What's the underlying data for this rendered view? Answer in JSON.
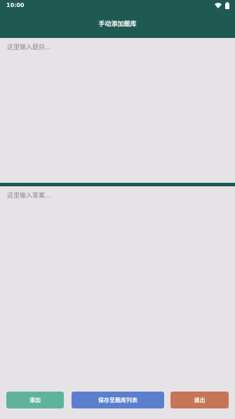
{
  "status_bar": {
    "time": "10:00",
    "icons": [
      "wifi-icon",
      "battery-icon"
    ]
  },
  "header": {
    "title": "手动添加题库"
  },
  "question_input": {
    "value": "",
    "placeholder": "这里输入题目..."
  },
  "answer_input": {
    "value": "",
    "placeholder": "这里输入答案..."
  },
  "buttons": {
    "add_label": "添加",
    "save_label": "保存至题库列表",
    "exit_label": "退出"
  },
  "colors": {
    "header_bg": "#1f5a52",
    "page_bg": "#e6e3e6",
    "add_button": "#5fb39d",
    "save_button": "#5b7fcc",
    "exit_button": "#c47659"
  }
}
